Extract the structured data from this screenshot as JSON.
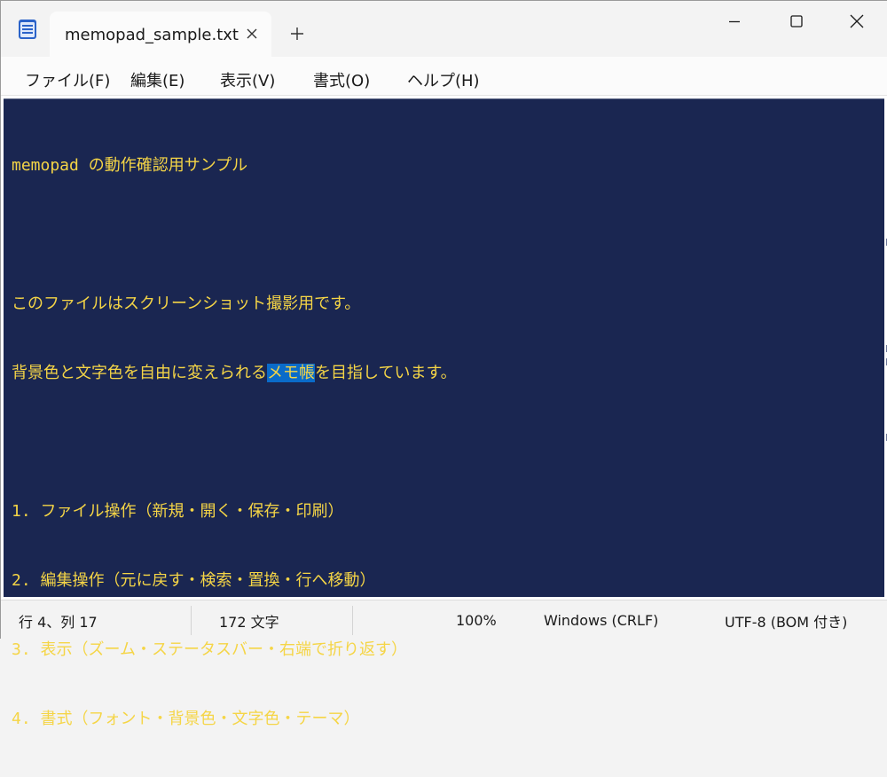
{
  "window": {
    "tab_title": "memopad_sample.txt"
  },
  "menu": [
    {
      "label": "ファイル(F)"
    },
    {
      "label": "編集(E)"
    },
    {
      "label": "表示(V)"
    },
    {
      "label": "書式(O)"
    },
    {
      "label": "ヘルプ(H)"
    }
  ],
  "editor": {
    "line1": "memopad の動作確認用サンプル",
    "line2": "",
    "line3": "このファイルはスクリーンショット撮影用です。",
    "line4_before": "背景色と文字色を自由に変えられる",
    "line4_selected": "メモ帳",
    "line4_after": "を目指しています。",
    "line5": "",
    "line6": "1. ファイル操作（新規・開く・保存・印刷）",
    "line7": "2. 編集操作（元に戻す・検索・置換・行へ移動）",
    "line8": "3. 表示（ズーム・ステータスバー・右端で折り返す）",
    "line9": "4. 書式（フォント・背景色・文字色・テーマ）",
    "background_color": "#1a2651",
    "text_color": "#f5d546",
    "selection_color": "#0a6bc9"
  },
  "status": {
    "position": "行 4、列 17",
    "char_count": "172 文字",
    "zoom": "100%",
    "line_ending": "Windows (CRLF)",
    "encoding": "UTF-8 (BOM 付き)"
  },
  "icons": {
    "app": "notepad-icon",
    "tab_close": "close-icon",
    "new_tab": "plus-icon",
    "minimize": "minimize-icon",
    "maximize": "maximize-icon",
    "close": "close-icon"
  }
}
